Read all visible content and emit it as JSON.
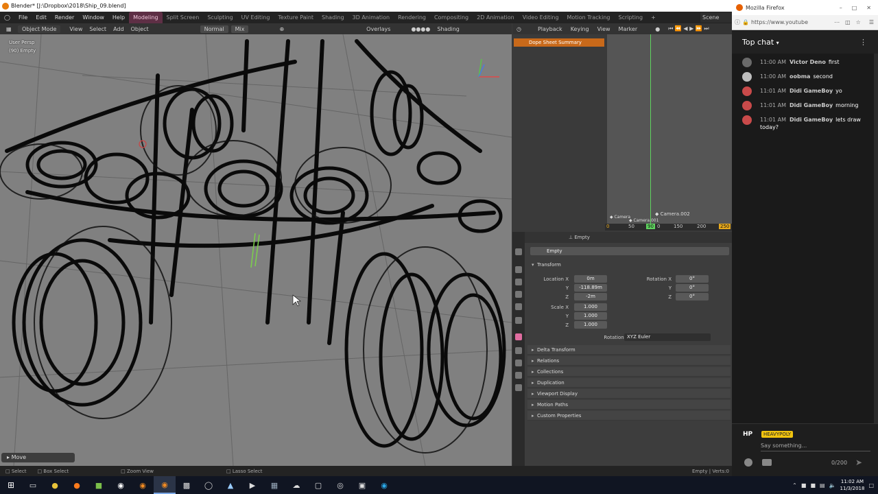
{
  "blender": {
    "window_title": "Blender* [J:\\Dropbox\\2018\\Ship_09.blend]",
    "menus": [
      "File",
      "Edit",
      "Render",
      "Window",
      "Help"
    ],
    "workspaces": [
      {
        "label": "Modeling",
        "active": true
      },
      {
        "label": "Split Screen",
        "active": false
      },
      {
        "label": "Sculpting",
        "active": false
      },
      {
        "label": "UV Editing",
        "active": false
      },
      {
        "label": "Texture Paint",
        "active": false
      },
      {
        "label": "Shading",
        "active": false
      },
      {
        "label": "3D Animation",
        "active": false
      },
      {
        "label": "Rendering",
        "active": false
      },
      {
        "label": "Compositing",
        "active": false
      },
      {
        "label": "2D Animation",
        "active": false
      },
      {
        "label": "Video Editing",
        "active": false
      },
      {
        "label": "Motion Tracking",
        "active": false
      },
      {
        "label": "Scripting",
        "active": false
      }
    ],
    "scene_label": "Scene",
    "viewport": {
      "mode": "Object Mode",
      "menus": [
        "View",
        "Select",
        "Add",
        "Object"
      ],
      "orientation": "Normal",
      "blend": "Mix",
      "overlays": "Overlays",
      "shading": "Shading",
      "view_name": "User Persp",
      "object_info": "(90) Empty",
      "last_op": "Move"
    },
    "dopesheet": {
      "menus": [
        "Playback",
        "Keying",
        "View",
        "Marker"
      ],
      "summary": "Dope Sheet Summary",
      "current_frame": "90",
      "ruler_ticks": [
        "0",
        "50",
        "0",
        "150",
        "200",
        "250"
      ],
      "markers": [
        "Camera",
        "Camera.001",
        "Camera.002"
      ]
    },
    "properties": {
      "breadcrumb": "Empty",
      "object_name": "Empty",
      "transform_title": "Transform",
      "location_label": "Location X",
      "location": {
        "x": "0m",
        "y": "-118.89m",
        "z": "-2m"
      },
      "rotation_label": "Rotation X",
      "rotation": {
        "x": "0°",
        "y": "0°",
        "z": "0°"
      },
      "scale_label": "Scale X",
      "scale": {
        "x": "1.000",
        "y": "1.000",
        "z": "1.000"
      },
      "axis_y": "Y",
      "axis_z": "Z",
      "rotation_mode_label": "Rotation Mode",
      "rotation_mode": "XYZ Euler",
      "panels": [
        "Delta Transform",
        "Relations",
        "Collections",
        "Duplication",
        "Viewport Display",
        "Motion Paths",
        "Custom Properties"
      ]
    },
    "status": {
      "select": "Select",
      "box_select": "Box Select",
      "zoom_view": "Zoom View",
      "lasso_select": "Lasso Select",
      "right": "Empty | Verts:0"
    }
  },
  "firefox": {
    "title": "Mozilla Firefox",
    "url": "https://www.youtube",
    "chat_title": "Top chat",
    "messages": [
      {
        "time": "11:00 AM",
        "author": "Victor Deno",
        "text": "first",
        "avatar_color": "#6a6a6a"
      },
      {
        "time": "11:00 AM",
        "author": "oobma",
        "text": "second",
        "avatar_color": "#bdbdbd"
      },
      {
        "time": "11:01 AM",
        "author": "Didi GameBoy",
        "text": "yo",
        "avatar_color": "#c94a4a"
      },
      {
        "time": "11:01 AM",
        "author": "Didi GameBoy",
        "text": "morning",
        "avatar_color": "#c94a4a"
      },
      {
        "time": "11:01 AM",
        "author": "Didi GameBoy",
        "text": "lets draw today?",
        "avatar_color": "#c94a4a"
      }
    ],
    "input": {
      "badge": "HP",
      "name": "HEAVYPOLY",
      "placeholder": "Say something...",
      "counter": "0/200"
    }
  },
  "taskbar": {
    "time": "11:02 AM",
    "date": "11/3/2018"
  },
  "colors": {
    "modeling_tab": "#5e2f45",
    "dopesheet_summary": "#c8691a",
    "playhead": "#5fd35f",
    "chat_name_badge": "#f1c40f"
  }
}
